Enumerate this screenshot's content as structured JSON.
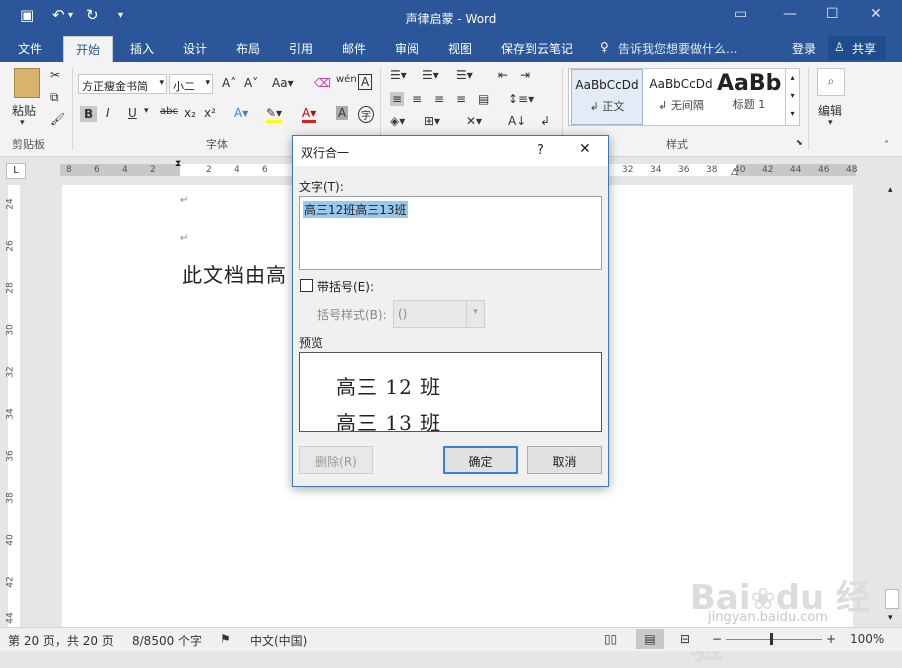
{
  "window": {
    "title": "声律启蒙 - Word"
  },
  "quick_access": {
    "save_icon": "save-icon",
    "undo_icon": "undo-icon",
    "redo_icon": "redo-icon"
  },
  "ribbon_tabs": [
    "文件",
    "开始",
    "插入",
    "设计",
    "布局",
    "引用",
    "邮件",
    "审阅",
    "视图",
    "保存到云笔记"
  ],
  "active_tab": "开始",
  "tell_me": "告诉我您想要做什么...",
  "account": {
    "login": "登录",
    "share": "共享"
  },
  "font": {
    "family": "方正瘦金书简",
    "size": "小二"
  },
  "groups": {
    "clipboard": "剪贴板",
    "font": "字体",
    "styles": "样式",
    "paste": "粘贴",
    "edit": "编辑"
  },
  "styles_gallery": [
    {
      "preview": "AaBbCcDd",
      "name": "↲ 正文"
    },
    {
      "preview": "AaBbCcDd",
      "name": "↲ 无间隔"
    },
    {
      "preview": "AaBb",
      "name": "标题 1"
    }
  ],
  "ruler": {
    "left_ticks": [
      "8",
      "6",
      "4",
      "2",
      "2",
      "4",
      "6"
    ],
    "right_ticks": [
      "32",
      "34",
      "36",
      "38",
      "40",
      "42",
      "44",
      "46",
      "48"
    ]
  },
  "vruler_ticks": [
    "24",
    "26",
    "28",
    "30",
    "32",
    "34",
    "36",
    "38",
    "40",
    "42",
    "44"
  ],
  "document": {
    "visible_line": "此文档由高",
    "paragraph_mark": "↵"
  },
  "dialog": {
    "title": "双行合一",
    "help": "?",
    "text_label": "文字(T):",
    "text_value": "高三12班高三13班",
    "bracket_label": "带括号(E):",
    "bracket_style_label": "括号样式(B):",
    "bracket_style_value": "()",
    "preview_label": "预览",
    "preview_lines": [
      "高三 12 班",
      "高三 13 班"
    ],
    "delete_btn": "删除(R)",
    "ok_btn": "确定",
    "cancel_btn": "取消"
  },
  "status": {
    "page": "第 20 页，共 20 页",
    "words": "8/8500 个字",
    "language": "中文(中国)",
    "zoom": "100%"
  },
  "watermark": {
    "brand": "Bai du 经验",
    "url": "jingyan.baidu.com"
  },
  "colors": {
    "accent": "#2b579a",
    "dialog_border": "#3a78c3",
    "selection": "#99c9ef"
  }
}
